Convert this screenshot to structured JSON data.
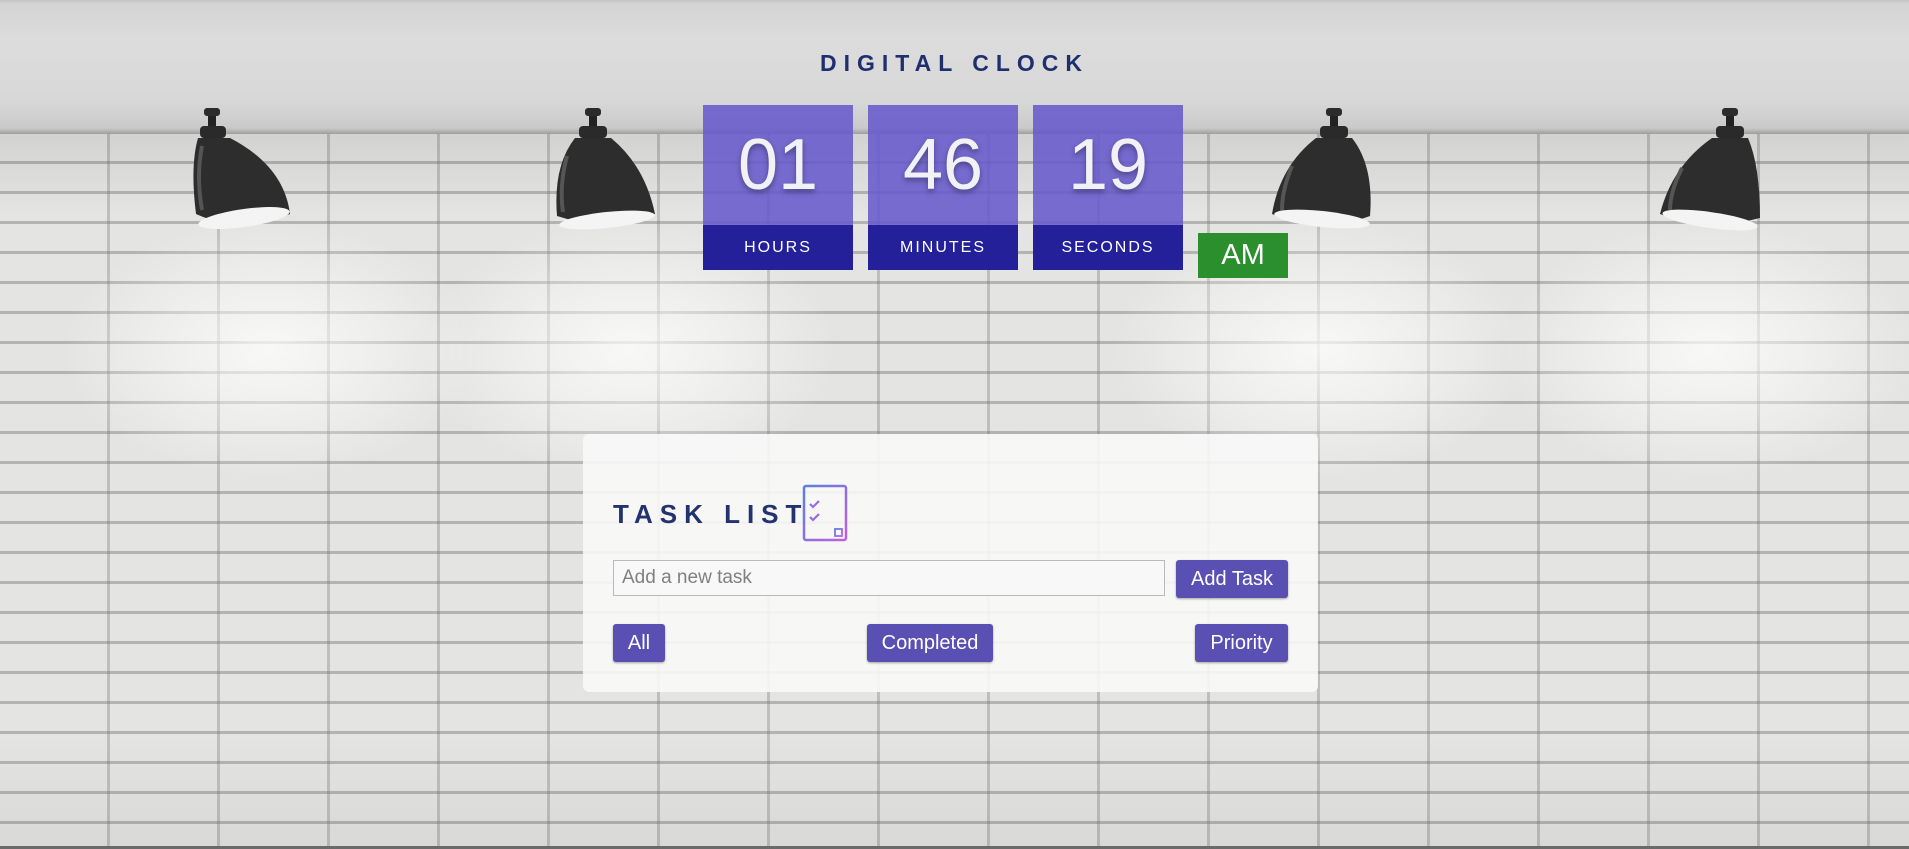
{
  "clock": {
    "title": "DIGITAL CLOCK",
    "hours": "01",
    "minutes": "46",
    "seconds": "19",
    "hours_label": "HOURS",
    "minutes_label": "MINUTES",
    "seconds_label": "SECONDS",
    "period": "AM"
  },
  "tasks": {
    "title": "TASK LIST",
    "input_placeholder": "Add a new task",
    "input_value": "",
    "add_button": "Add Task",
    "filters": {
      "all": "All",
      "completed": "Completed",
      "priority": "Priority"
    }
  },
  "icons": {
    "lamp": "pendant-lamp-icon",
    "task_list": "checklist-icon"
  },
  "colors": {
    "clock_digits_bg": "#685acd",
    "clock_label_bg": "#23209a",
    "period_bg": "#2a8f2c",
    "button_bg": "#5a4fb3",
    "title_color": "#1f2f6e"
  }
}
